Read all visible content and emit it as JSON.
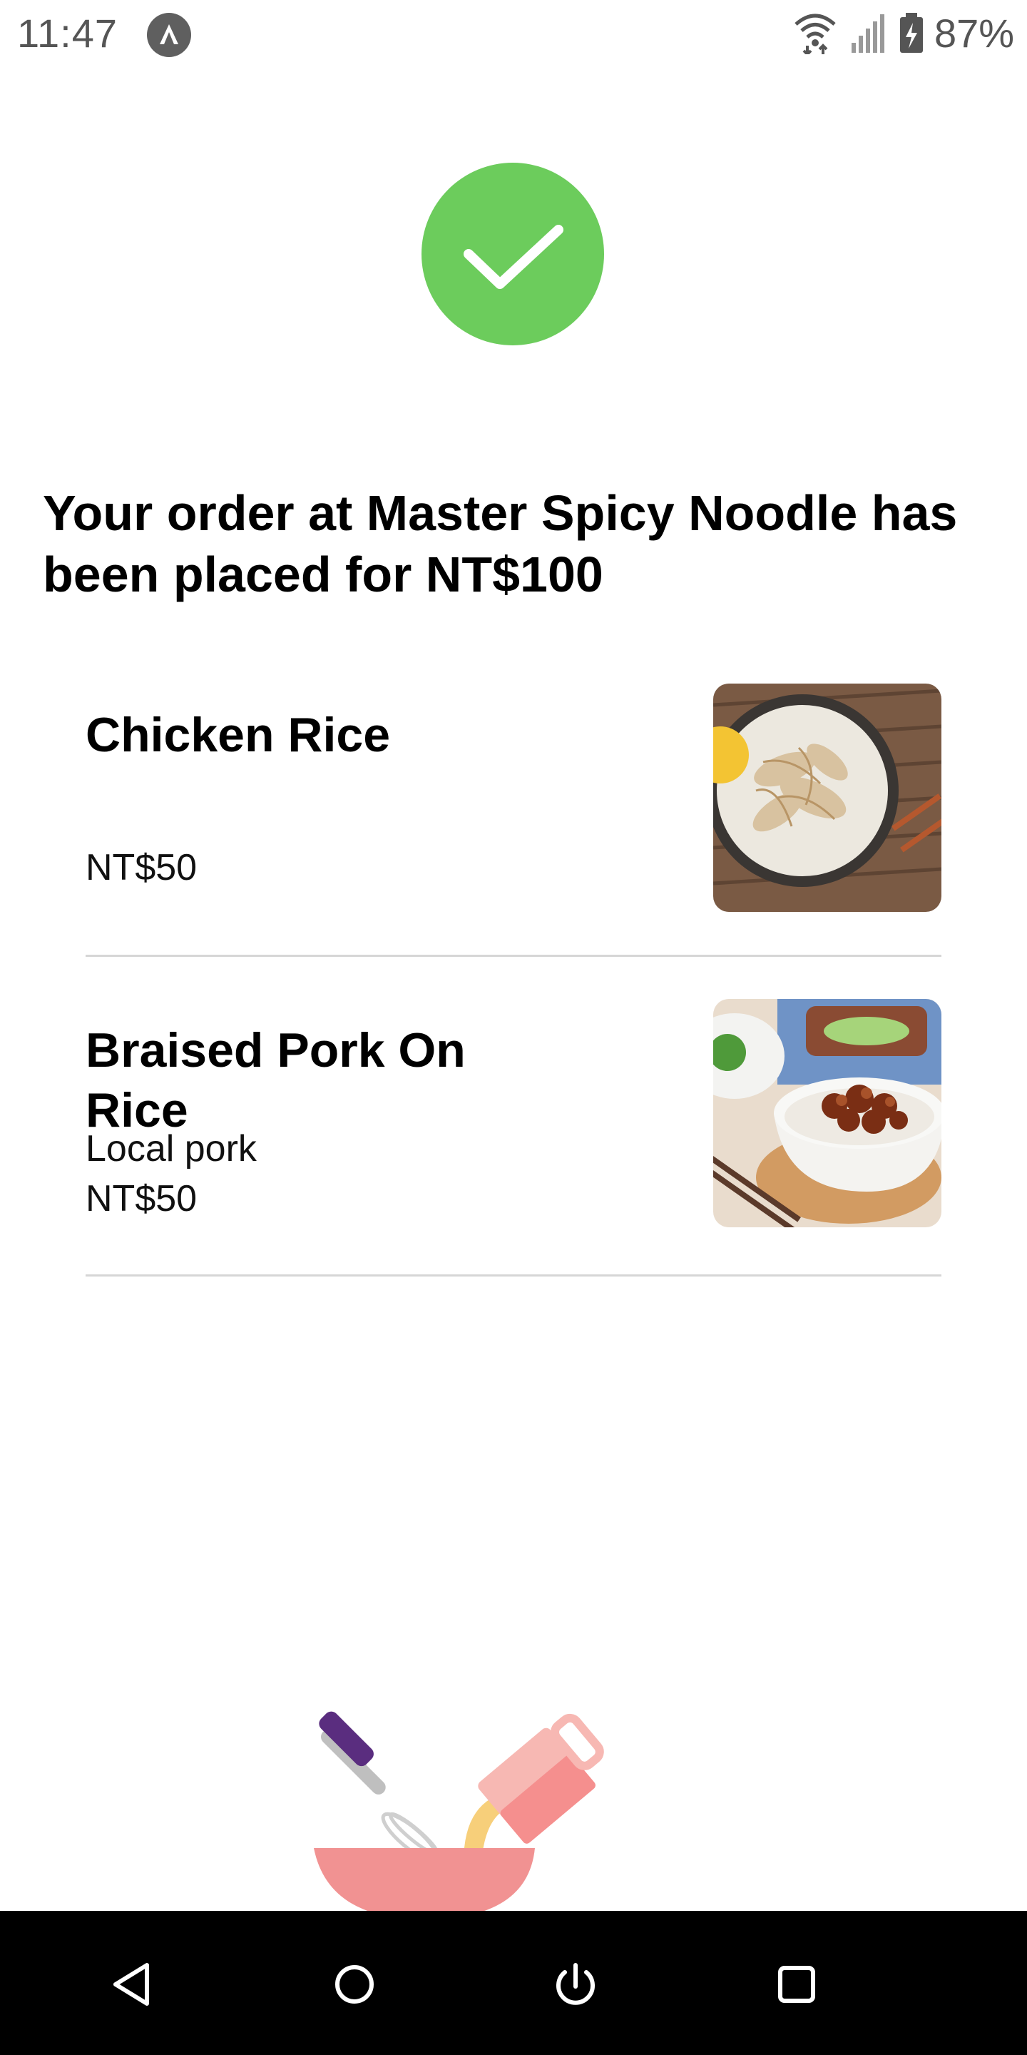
{
  "status_bar": {
    "time": "11:47",
    "battery": "87%",
    "icons": [
      "app-notification-icon",
      "wifi-icon",
      "signal-icon",
      "battery-charging-icon"
    ]
  },
  "confirmation": {
    "icon": "checkmark-icon",
    "accent_color": "#6CCC5C",
    "headline": "Your order at Master Spicy Noodle has been placed for NT$100"
  },
  "order_items": [
    {
      "name": "Chicken Rice",
      "description": "",
      "price": "NT$50",
      "image": "chicken-rice-photo"
    },
    {
      "name": "Braised Pork On Rice",
      "description": "Local pork",
      "price": "NT$50",
      "image": "braised-pork-rice-photo"
    }
  ],
  "illustration": "mixing-bowl-illustration",
  "nav_bar": {
    "buttons": [
      "back-icon",
      "home-icon",
      "power-icon",
      "recents-icon"
    ]
  }
}
